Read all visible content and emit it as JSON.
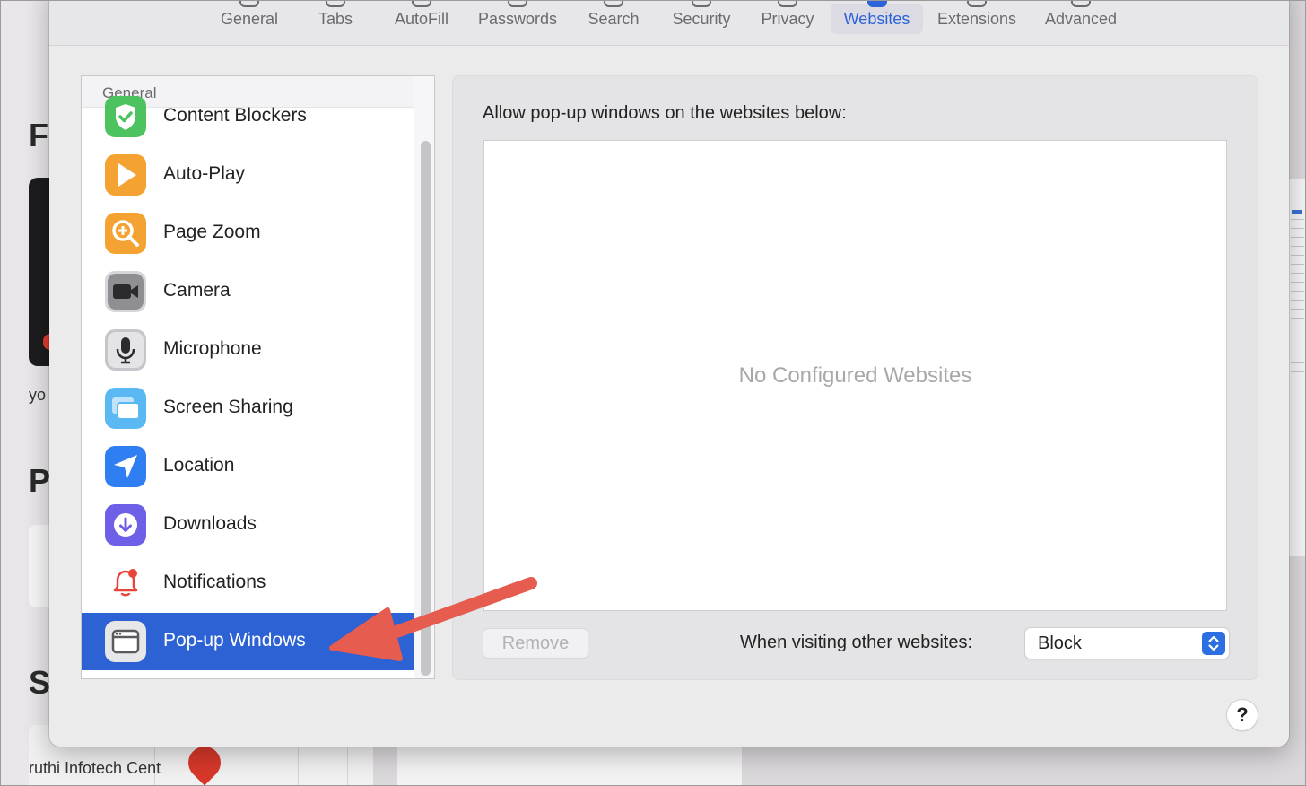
{
  "background": {
    "letters": [
      "F",
      "P",
      "S"
    ],
    "small_text": "yo",
    "map_text": "ruthi Infotech Cent"
  },
  "toolbar": {
    "tabs": [
      {
        "label": "General",
        "icon": "gear-icon"
      },
      {
        "label": "Tabs",
        "icon": "tabs-icon"
      },
      {
        "label": "AutoFill",
        "icon": "autofill-icon"
      },
      {
        "label": "Passwords",
        "icon": "key-icon"
      },
      {
        "label": "Search",
        "icon": "magnifier-icon"
      },
      {
        "label": "Security",
        "icon": "lock-icon"
      },
      {
        "label": "Privacy",
        "icon": "hand-icon"
      },
      {
        "label": "Websites",
        "icon": "globe-icon",
        "active": true
      },
      {
        "label": "Extensions",
        "icon": "puzzle-icon"
      },
      {
        "label": "Advanced",
        "icon": "gears-icon"
      }
    ]
  },
  "sidebar": {
    "header": "General",
    "items": [
      {
        "label": "Content Blockers",
        "icon": "shield-check-icon",
        "color": "#4cc35f"
      },
      {
        "label": "Auto-Play",
        "icon": "play-icon",
        "color": "#f4a232"
      },
      {
        "label": "Page Zoom",
        "icon": "zoom-in-icon",
        "color": "#f4a232"
      },
      {
        "label": "Camera",
        "icon": "camera-icon",
        "color": "#4d4d50"
      },
      {
        "label": "Microphone",
        "icon": "microphone-icon",
        "color": "#a9a9ad"
      },
      {
        "label": "Screen Sharing",
        "icon": "screen-sharing-icon",
        "color": "#5ab8f2"
      },
      {
        "label": "Location",
        "icon": "location-arrow-icon",
        "color": "#2f7ef2"
      },
      {
        "label": "Downloads",
        "icon": "download-icon",
        "color": "#6d5fe6"
      },
      {
        "label": "Notifications",
        "icon": "bell-icon",
        "color": "#e9443a"
      },
      {
        "label": "Pop-up Windows",
        "icon": "popup-window-icon",
        "color": "#e7e7ea",
        "selected": true
      }
    ]
  },
  "pane": {
    "title": "Allow pop-up windows on the websites below:",
    "empty_text": "No Configured Websites",
    "remove_label": "Remove",
    "visiting_label": "When visiting other websites:",
    "visiting_value": "Block"
  },
  "help_label": "?",
  "colors": {
    "accent": "#2c62d4",
    "annotation_arrow": "#e65c4f"
  }
}
